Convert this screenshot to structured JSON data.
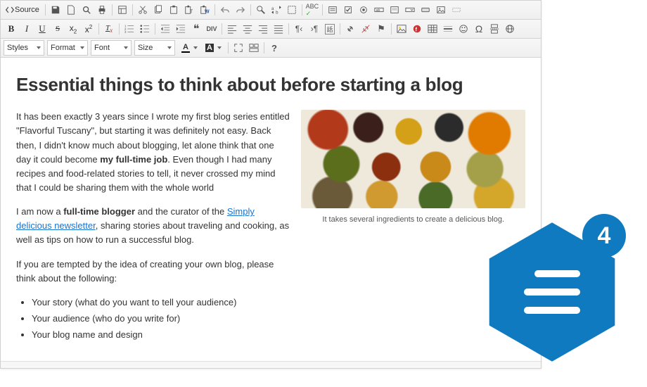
{
  "toolbar": {
    "row1": {
      "source": "Source",
      "save": "save",
      "new_page": "new-page",
      "preview": "preview",
      "print": "print",
      "templates": "templates",
      "cut": "cut",
      "copy": "copy",
      "paste": "paste",
      "paste_text": "paste-as-text",
      "paste_word": "paste-from-word",
      "undo": "undo",
      "redo": "redo",
      "find": "find",
      "replace": "replace",
      "select_all": "select-all",
      "spellcheck": "spellcheck",
      "form": "form",
      "checkbox": "checkbox",
      "radio": "radio",
      "textfield": "text-field",
      "textarea": "textarea",
      "select": "select-field",
      "button_field": "button-field",
      "image_button": "image-button",
      "hidden": "hidden-field"
    },
    "row2": {
      "bold": "B",
      "italic": "I",
      "underline": "U",
      "strike": "S",
      "subscript": "x₂",
      "superscript": "x²",
      "remove_format": "Tx",
      "numbered_list": "numbered-list",
      "bulleted_list": "bulleted-list",
      "outdent": "outdent",
      "indent": "indent",
      "blockquote": "blockquote",
      "div": "div",
      "align_left": "align-left",
      "align_center": "align-center",
      "align_right": "align-right",
      "justify": "justify",
      "ltr": "ltr",
      "rtl": "rtl",
      "language": "language",
      "link": "link",
      "unlink": "unlink",
      "anchor": "anchor",
      "image": "image",
      "flash": "flash",
      "table": "table",
      "hr": "horizontal-rule",
      "smiley": "smiley",
      "special_char": "special-char",
      "page_break": "page-break",
      "iframe": "iframe"
    },
    "row3": {
      "styles": "Styles",
      "format": "Format",
      "font": "Font",
      "size": "Size",
      "text_color": "text-color",
      "bg_color": "bg-color",
      "maximize": "maximize",
      "show_blocks": "show-blocks",
      "about": "?"
    }
  },
  "content": {
    "heading": "Essential things to think about before starting a blog",
    "p1a": "It has been exactly 3 years since I wrote my first blog series entitled \"Flavorful Tuscany\", but starting it was definitely not easy. Back then, I didn't know much about blogging, let alone think that one day it could become ",
    "p1b_bold": "my full-time job",
    "p1c": ". Even though I had many recipes and food-related stories to tell, it never crossed my mind that I could be sharing them with the whole world",
    "p2a": "I am now a ",
    "p2b_bold": "full-time blogger",
    "p2c": " and the curator of the ",
    "p2_link": "Simply delicious newsletter",
    "p2d": ", sharing stories about traveling and cooking, as well as tips on how to run a successful blog.",
    "p3": "If you are tempted by the idea of creating your own blog, please think about the following:",
    "bullets": [
      "Your story (what do you want to tell your audience)",
      "Your audience (who do you write for)",
      "Your blog name and design"
    ],
    "caption": "It takes several ingredients to create a delicious blog."
  },
  "badge": {
    "number": "4"
  },
  "colors": {
    "brand": "#107ac0"
  }
}
